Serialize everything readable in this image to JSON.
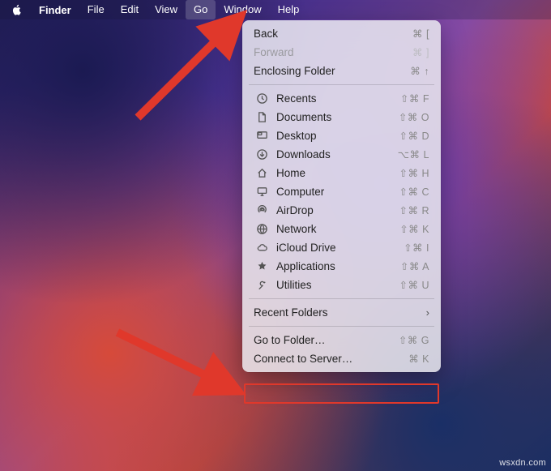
{
  "menubar": {
    "app_name": "Finder",
    "items": [
      "File",
      "Edit",
      "View",
      "Go",
      "Window",
      "Help"
    ],
    "active_index": 3
  },
  "dropdown": {
    "nav": {
      "back": {
        "label": "Back",
        "shortcut": "⌘ ["
      },
      "forward": {
        "label": "Forward",
        "shortcut": "⌘ ]"
      },
      "enclosing": {
        "label": "Enclosing Folder",
        "shortcut": "⌘ ↑"
      }
    },
    "places": [
      {
        "id": "recents",
        "label": "Recents",
        "shortcut": "⇧⌘ F"
      },
      {
        "id": "documents",
        "label": "Documents",
        "shortcut": "⇧⌘ O"
      },
      {
        "id": "desktop",
        "label": "Desktop",
        "shortcut": "⇧⌘ D"
      },
      {
        "id": "downloads",
        "label": "Downloads",
        "shortcut": "⌥⌘ L"
      },
      {
        "id": "home",
        "label": "Home",
        "shortcut": "⇧⌘ H"
      },
      {
        "id": "computer",
        "label": "Computer",
        "shortcut": "⇧⌘ C"
      },
      {
        "id": "airdrop",
        "label": "AirDrop",
        "shortcut": "⇧⌘ R"
      },
      {
        "id": "network",
        "label": "Network",
        "shortcut": "⇧⌘ K"
      },
      {
        "id": "icloud-drive",
        "label": "iCloud Drive",
        "shortcut": "⇧⌘ I"
      },
      {
        "id": "applications",
        "label": "Applications",
        "shortcut": "⇧⌘ A"
      },
      {
        "id": "utilities",
        "label": "Utilities",
        "shortcut": "⇧⌘ U"
      }
    ],
    "recent_folders": {
      "label": "Recent Folders"
    },
    "goto": {
      "label": "Go to Folder…",
      "shortcut": "⇧⌘ G"
    },
    "connect": {
      "label": "Connect to Server…",
      "shortcut": "⌘ K"
    }
  },
  "annotations": {
    "arrow_color": "#e0382b",
    "highlight_color": "#e0382b"
  },
  "watermark": "wsxdn.com"
}
